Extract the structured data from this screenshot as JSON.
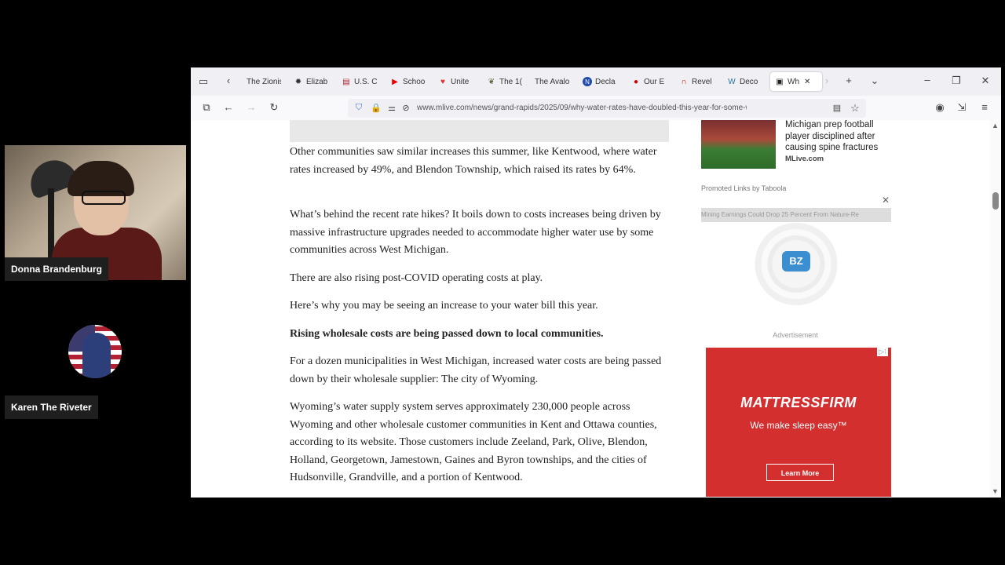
{
  "participants": [
    {
      "name": "Donna Brandenburg"
    },
    {
      "name": "Karen The Riveter"
    }
  ],
  "browser": {
    "tabs": [
      {
        "label": "The Zionis",
        "icon": "document-icon",
        "icon_glyph": ""
      },
      {
        "label": "Elizab",
        "icon": "gear-black-icon",
        "icon_glyph": "✹"
      },
      {
        "label": "U.S. C",
        "icon": "us-flag-icon",
        "icon_glyph": "▤"
      },
      {
        "label": "Schoo",
        "icon": "youtube-icon",
        "icon_glyph": "▶"
      },
      {
        "label": "Unite",
        "icon": "heart-icon",
        "icon_glyph": "♥"
      },
      {
        "label": "The 1(",
        "icon": "ribbon-icon",
        "icon_glyph": "❦"
      },
      {
        "label": "The Avalo",
        "icon": "document-icon",
        "icon_glyph": ""
      },
      {
        "label": "Decla",
        "icon": "n-circle-icon",
        "icon_glyph": "N"
      },
      {
        "label": "Our E",
        "icon": "red-circle-icon",
        "icon_glyph": "●"
      },
      {
        "label": "Revel",
        "icon": "red-arc-icon",
        "icon_glyph": "∩"
      },
      {
        "label": "Deco",
        "icon": "wordpress-icon",
        "icon_glyph": "W"
      },
      {
        "label": "Wh",
        "icon": "mlive-icon",
        "icon_glyph": "▣",
        "active": true
      }
    ],
    "url": "www.mlive.com/news/grand-rapids/2025/09/why-water-rates-have-doubled-this-year-for-some-west-mi..."
  },
  "article": {
    "paragraphs": [
      "Other communities saw similar increases this summer, like Kentwood, where water rates increased by 49%, and Blendon Township, which raised its rates by 64%.",
      "What’s behind the recent rate hikes? It boils down to costs increases being driven by massive infrastructure upgrades needed to accommodate higher water use by some communities across West Michigan.",
      "There are also rising post-COVID operating costs at play.",
      "Here’s why you may be seeing an increase to your water bill this year.",
      "Rising wholesale costs are being passed down to local communities.",
      "For a dozen municipalities in West Michigan, increased water costs are being passed down by their wholesale supplier: The city of Wyoming.",
      "Wyoming’s water supply system serves approximately 230,000 people across Wyoming and other wholesale customer communities in Kent and Ottawa counties, according to its website. Those customers include Zeeland, Park, Olive, Blendon, Holland, Georgetown, Jamestown, Gaines and Byron townships, and the cities of Hudsonville, Grandville, and a portion of Kentwood."
    ]
  },
  "sidebar": {
    "promo_title": "Michigan prep football player disciplined after causing spine fractures",
    "promo_source": "MLive.com",
    "taboola_label": "Promoted Links by Taboola",
    "video_ad_caption": "Mining Earnings Could Drop 25 Percent From Nature-Re",
    "video_ad_logo": "BZ",
    "ad_label": "Advertisement",
    "mattress_brand": "MATTRESSFIRM",
    "mattress_tagline": "We make sleep easy™",
    "mattress_button": "Learn More"
  },
  "colors": {
    "ad_red": "#d32f2f",
    "bz_blue": "#3b8ed0"
  }
}
